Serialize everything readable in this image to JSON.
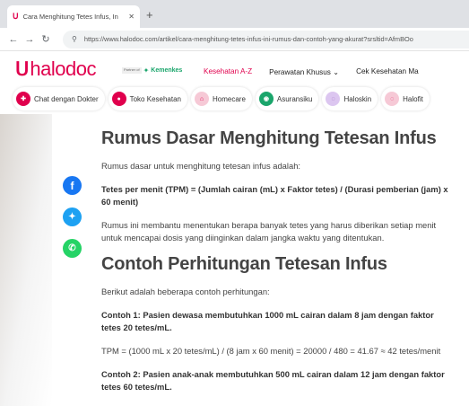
{
  "browser": {
    "tab_title": "Cara Menghitung Tetes Infus, In",
    "url": "https://www.halodoc.com/artikel/cara-menghitung-tetes-infus-ini-rumus-dan-contoh-yang-akurat?srsltid=AfmBOo"
  },
  "header": {
    "logo": "halodoc",
    "partner_badge": "Partner\nof",
    "partner_name": "Kemenkes",
    "nav": [
      "Kesehatan A-Z",
      "Perawatan Khusus",
      "Cek Kesehatan Ma"
    ]
  },
  "chips": [
    {
      "label": "Chat dengan Dokter",
      "icon": "chat-doctor-icon",
      "color": "#e0004d"
    },
    {
      "label": "Toko Kesehatan",
      "icon": "health-store-icon",
      "color": "#e0004d"
    },
    {
      "label": "Homecare",
      "icon": "homecare-icon",
      "color": "#e0004d"
    },
    {
      "label": "Asuransiku",
      "icon": "insurance-icon",
      "color": "#1aa56b"
    },
    {
      "label": "Haloskin",
      "icon": "haloskin-icon",
      "color": "#b96bd6"
    },
    {
      "label": "Halofit",
      "icon": "halofit-icon",
      "color": "#e0004d"
    }
  ],
  "article": {
    "h1": "Rumus Dasar Menghitung Tetesan Infus",
    "p1": "Rumus dasar untuk menghitung tetesan infus adalah:",
    "formula": "Tetes per menit (TPM) = (Jumlah cairan (mL) x Faktor tetes) / (Durasi pemberian (jam) x 60 menit)",
    "p2": "Rumus ini membantu menentukan berapa banyak tetes yang harus diberikan setiap menit untuk mencapai dosis yang diinginkan dalam jangka waktu yang ditentukan.",
    "h2": "Contoh Perhitungan Tetesan Infus",
    "p3": "Berikut adalah beberapa contoh perhitungan:",
    "ex1": "Contoh 1: Pasien dewasa membutuhkan 1000 mL cairan dalam 8 jam dengan faktor tetes 20 tetes/mL.",
    "ex1_calc": "TPM = (1000 mL x 20 tetes/mL) / (8 jam x 60 menit) = 20000 / 480 = 41.67 ≈ 42 tetes/menit",
    "ex2": "Contoh 2: Pasien anak-anak membutuhkan 500 mL cairan dalam 12 jam dengan faktor tetes 60 tetes/mL."
  },
  "colors": {
    "brand": "#e0004d",
    "facebook": "#1877f2",
    "twitter": "#1da1f2",
    "whatsapp": "#25d366"
  }
}
